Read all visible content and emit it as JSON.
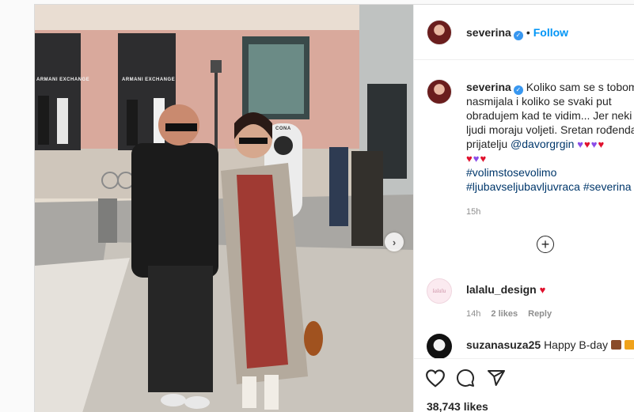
{
  "post": {
    "store_sign_left": "ARMANI EXCHANGE",
    "store_sign_right": "ARMANI EXCHANGE",
    "kiosk_sign": "CONA",
    "next_arrow": "›"
  },
  "header": {
    "username": "severina",
    "verified_mark": "✓",
    "separator": "•",
    "follow_label": "Follow"
  },
  "caption": {
    "username": "severina",
    "line1": "Koliko sam se s tobom",
    "line2": "nasmijala i koliko se svaki put",
    "line3": "obradujem kad te vidim... Jer neki s",
    "line4": "ljudi moraju voljeti. Sretan rođenda",
    "line5_text": "prijatelju ",
    "mention": "@davorgrgin",
    "hashtag1": "#volimstosevolimo",
    "hashtag2": "#ljubavseljubavljuvraca",
    "hashtag3": "#severina",
    "time": "15h"
  },
  "load_more": "+",
  "comments": [
    {
      "username": "lalalu_design",
      "avatar_text": "lalalu",
      "text": "",
      "time": "14h",
      "likes": "2 likes",
      "reply": "Reply"
    },
    {
      "username": "suzanasuza25",
      "text": "Happy B-day"
    }
  ],
  "likes_count": "38,743 likes",
  "colors": {
    "link": "#00376b",
    "follow": "#0095f6",
    "verified": "#3897f0",
    "heart_red": "#e0112d",
    "heart_purple": "#8a4de8"
  },
  "icons": [
    "verified-icon",
    "heart-icon",
    "purple-heart-icon",
    "red-heart-icon",
    "comment-icon",
    "share-icon",
    "add-circle-icon",
    "chevron-right-icon",
    "cake-icon",
    "gift-icon"
  ]
}
